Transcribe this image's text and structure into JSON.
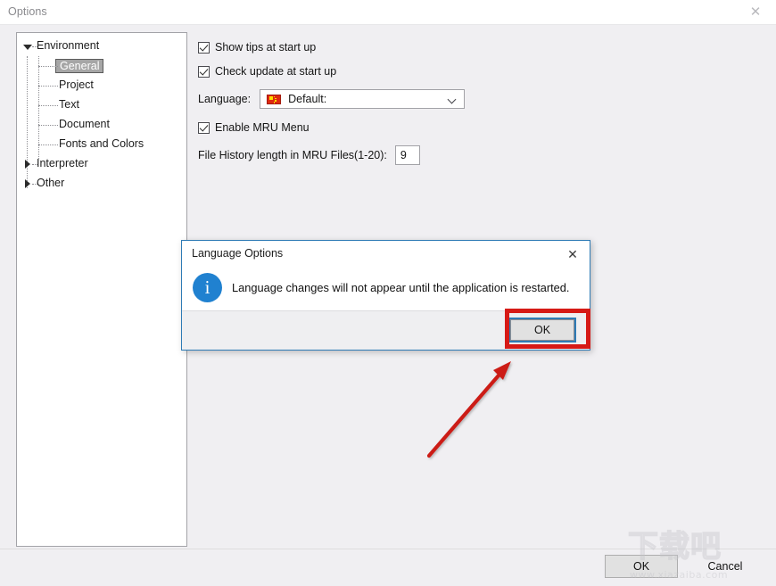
{
  "window": {
    "title": "Options",
    "close_icon": "close-icon"
  },
  "tree": {
    "nodes": [
      {
        "label": "Environment",
        "level": 1,
        "expander": "triangle-down",
        "selected": false
      },
      {
        "label": "General",
        "level": 2,
        "expander": "none",
        "selected": true
      },
      {
        "label": "Project",
        "level": 2,
        "expander": "none",
        "selected": false
      },
      {
        "label": "Text",
        "level": 2,
        "expander": "none",
        "selected": false
      },
      {
        "label": "Document",
        "level": 2,
        "expander": "none",
        "selected": false
      },
      {
        "label": "Fonts and Colors",
        "level": 2,
        "expander": "none",
        "selected": false
      },
      {
        "label": "Interpreter",
        "level": 1,
        "expander": "triangle-right",
        "selected": false
      },
      {
        "label": "Other",
        "level": 1,
        "expander": "triangle-right",
        "selected": false
      }
    ]
  },
  "settings": {
    "show_tips": {
      "label": "Show tips at start up",
      "checked": true
    },
    "check_update": {
      "label": "Check update at start up",
      "checked": true
    },
    "language": {
      "label": "Language:",
      "value": "Default:",
      "flag_icon": "china-flag-icon",
      "chevron_icon": "chevron-down-icon"
    },
    "enable_mru": {
      "label": "Enable MRU Menu",
      "checked": true
    },
    "file_history": {
      "label": "File History length in MRU Files(1-20):",
      "value": "9"
    }
  },
  "footer": {
    "ok_label": "OK",
    "cancel_label": "Cancel"
  },
  "dialog": {
    "title": "Language Options",
    "close_icon": "close-icon",
    "info_icon": "i",
    "message": "Language changes will not appear until the application is restarted.",
    "ok_label": "OK"
  },
  "annotations": {
    "highlight_color": "#d61a16",
    "arrow_color": "#cc1b16",
    "focus_color": "#2e7bb5"
  },
  "watermark": {
    "logo_text": "下载吧",
    "url": "www.xiazaiba.com"
  }
}
